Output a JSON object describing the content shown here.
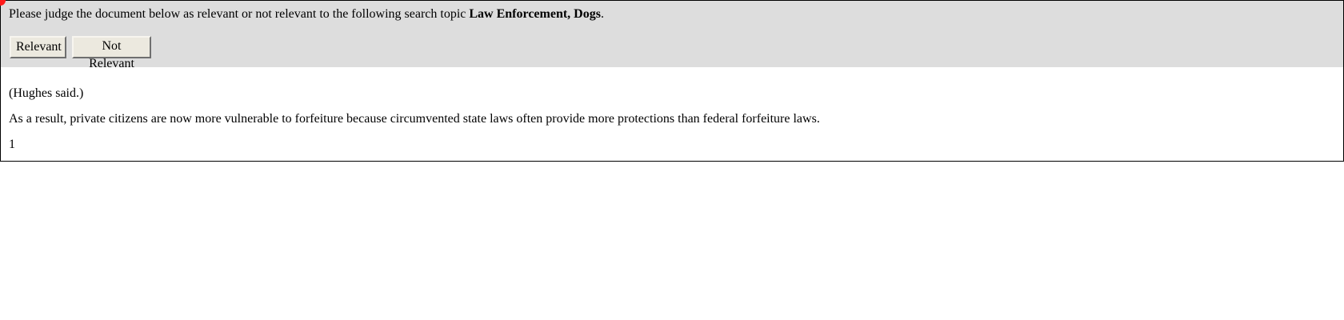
{
  "header": {
    "instruction_prefix": "Please judge the document below as relevant or not relevant to the following search topic ",
    "topic": "Law Enforcement, Dogs",
    "instruction_suffix": ".",
    "relevant_label": "Relevant",
    "not_relevant_label": "Not Relevant"
  },
  "document": {
    "paragraphs": [
      "(Hughes said.)",
      "As a result, private citizens are now more vulnerable to forfeiture because circumvented state laws often provide more protections than federal forfeiture laws.",
      "1"
    ]
  },
  "colors": {
    "header_bg": "#dddddd",
    "button_bg": "#ece9df",
    "cursor_marker": "#ff1a1a"
  }
}
